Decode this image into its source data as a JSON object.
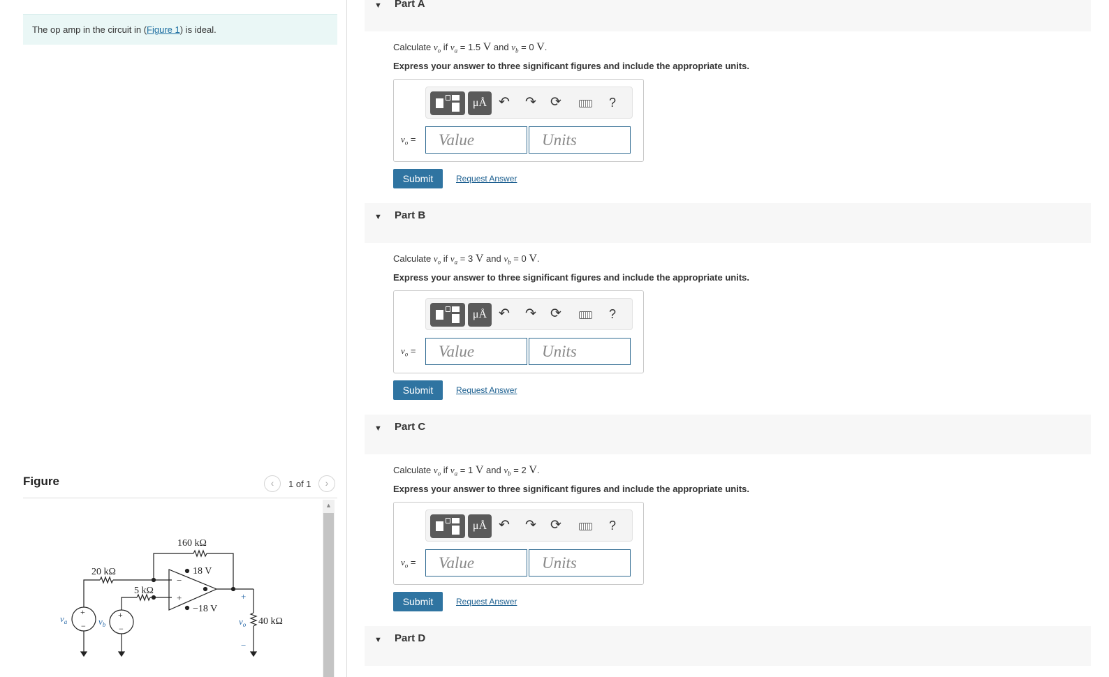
{
  "intro": {
    "text_before": "The op amp in the circuit in (",
    "link": "Figure 1",
    "text_after": ") is ideal."
  },
  "figure": {
    "title": "Figure",
    "counter": "1 of 1",
    "prev_icon": "chevron-left-icon",
    "next_icon": "chevron-right-icon",
    "circuit": {
      "r_feedback": "160 kΩ",
      "r_a": "20 kΩ",
      "r_b": "5 kΩ",
      "r_load": "40 kΩ",
      "supply_pos": "18 V",
      "supply_neg": "−18 V",
      "src_a": "v",
      "src_a_sub": "a",
      "src_b": "v",
      "src_b_sub": "b",
      "out": "v",
      "out_sub": "o",
      "plus": "+",
      "minus": "−"
    }
  },
  "parts": [
    {
      "title": "Part A",
      "va": "1.5",
      "vb": "0"
    },
    {
      "title": "Part B",
      "va": "3",
      "vb": "0"
    },
    {
      "title": "Part C",
      "va": "1",
      "vb": "2"
    },
    {
      "title": "Part D"
    }
  ],
  "common": {
    "calculate": "Calculate",
    "vo_var": "v",
    "vo_sub": "o",
    "if": "if",
    "va_var": "v",
    "va_sub": "a",
    "eq": "=",
    "and": "and",
    "vb_var": "v",
    "vb_sub": "b",
    "unit": "V",
    "period": ".",
    "instruction": "Express your answer to three significant figures and include the appropriate units.",
    "answer_label": "=",
    "value_placeholder": "Value",
    "units_placeholder": "Units",
    "units_button": "μÅ",
    "help": "?",
    "submit": "Submit",
    "request": "Request Answer"
  },
  "colors": {
    "accent": "#2f74a1",
    "intro_bg": "#eaf7f6",
    "link": "#1c6da0"
  }
}
